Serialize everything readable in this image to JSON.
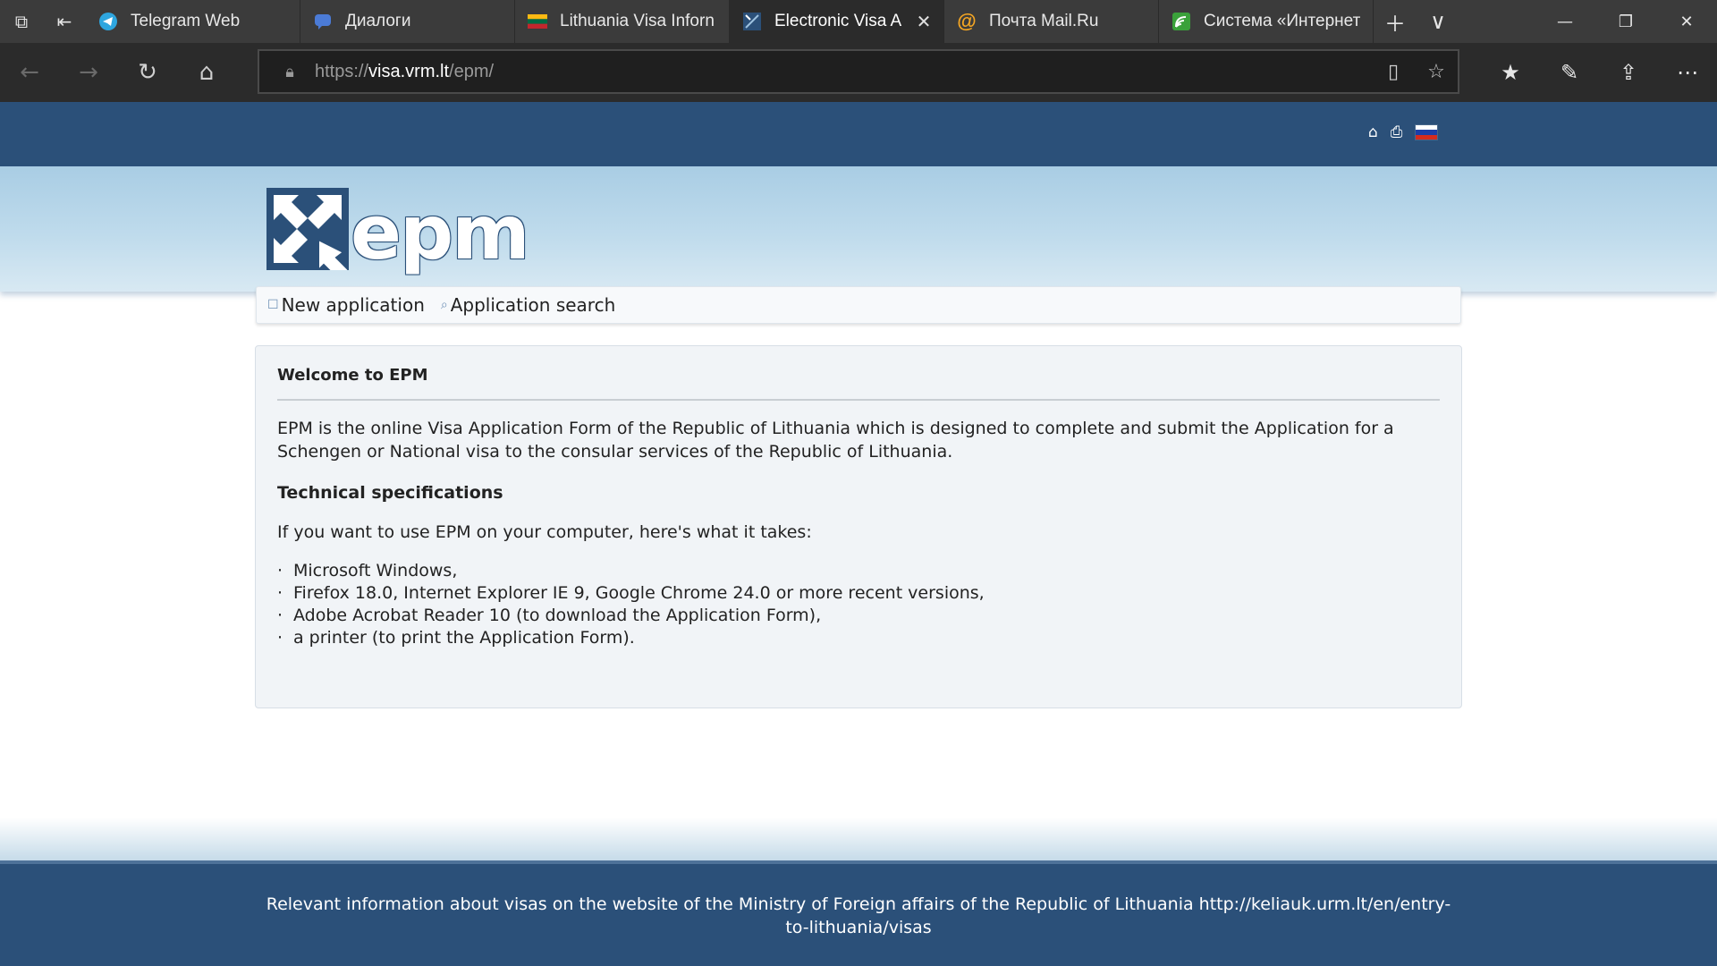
{
  "browser": {
    "tabs": [
      {
        "title": "Telegram Web",
        "icon": "telegram-icon",
        "active": false
      },
      {
        "title": "Диалоги",
        "icon": "chat-icon",
        "active": false
      },
      {
        "title": "Lithuania Visa Inforn",
        "icon": "lithuania-flag-icon",
        "active": false
      },
      {
        "title": "Electronic Visa A",
        "icon": "epm-icon",
        "active": true
      },
      {
        "title": "Почта Mail.Ru",
        "icon": "mail-ru-icon",
        "active": false
      },
      {
        "title": "Система «Интернет",
        "icon": "system-icon",
        "active": false
      }
    ],
    "address": {
      "prefix": "https://",
      "host": "visa.vrm.lt",
      "path": "/epm/"
    }
  },
  "site": {
    "logo_text": "epm",
    "menu": {
      "new_application": "New application",
      "application_search": "Application search"
    },
    "flag_colors": [
      "#ffffff",
      "#1c3fa8",
      "#d52b1e"
    ]
  },
  "content": {
    "title": "Welcome to EPM",
    "intro": "EPM is the online Visa Application Form of the Republic of Lithuania which is designed to complete and submit the Application for a Schengen or National visa to the consular services of the Republic of Lithuania.",
    "tech_heading": "Technical specifications",
    "requirements_intro": "If you want to use EPM on your computer, here's what it takes:",
    "requirements": [
      "Microsoft Windows,",
      "Firefox 18.0, Internet Explorer IE 9, Google Chrome 24.0 or more recent versions,",
      "Adobe Acrobat Reader 10 (to download the Application Form),",
      "a printer (to print the Application Form)."
    ]
  },
  "footer": {
    "text": "Relevant information about visas on the website of the Ministry of Foreign affairs of the Republic of Lithuania http://keliauk.urm.lt/en/entry-to-lithuania/visas"
  }
}
